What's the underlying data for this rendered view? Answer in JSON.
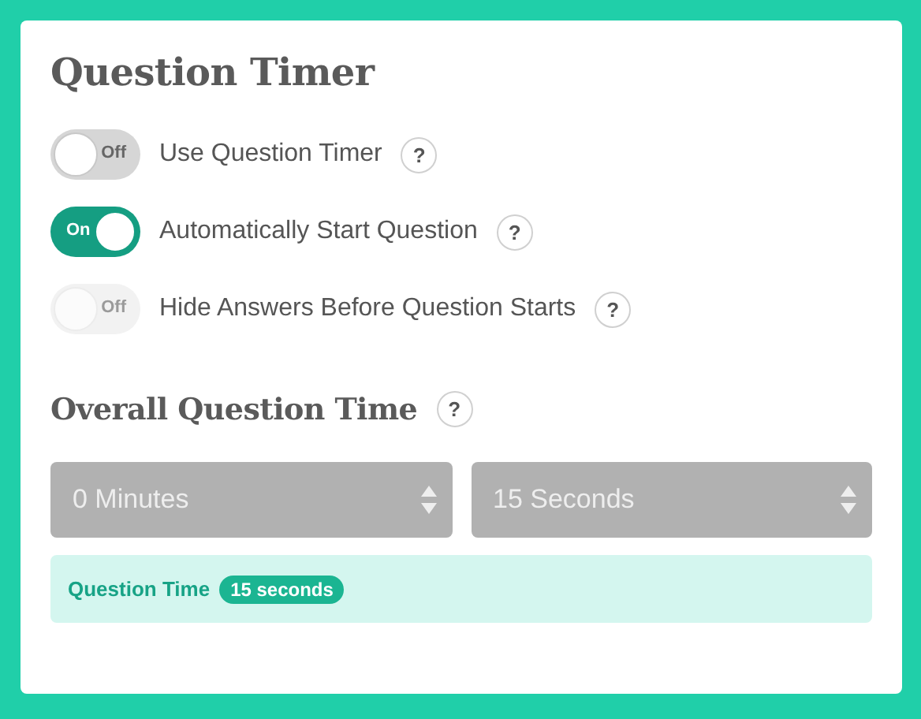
{
  "title": "Question Timer",
  "toggles": [
    {
      "label": "Use Question Timer",
      "switch_text": "Off",
      "on": false,
      "disabled": false,
      "help": "?"
    },
    {
      "label": "Automatically Start Question",
      "switch_text": "On",
      "on": true,
      "disabled": false,
      "help": "?"
    },
    {
      "label": "Hide Answers Before Question Starts",
      "switch_text": "Off",
      "on": false,
      "disabled": true,
      "help": "?"
    }
  ],
  "section": {
    "title": "Overall Question Time",
    "help": "?"
  },
  "selects": [
    {
      "value": "0 Minutes",
      "disabled": true
    },
    {
      "value": "15 Seconds",
      "disabled": true
    }
  ],
  "summary": {
    "label": "Question Time",
    "badge": "15 seconds"
  }
}
